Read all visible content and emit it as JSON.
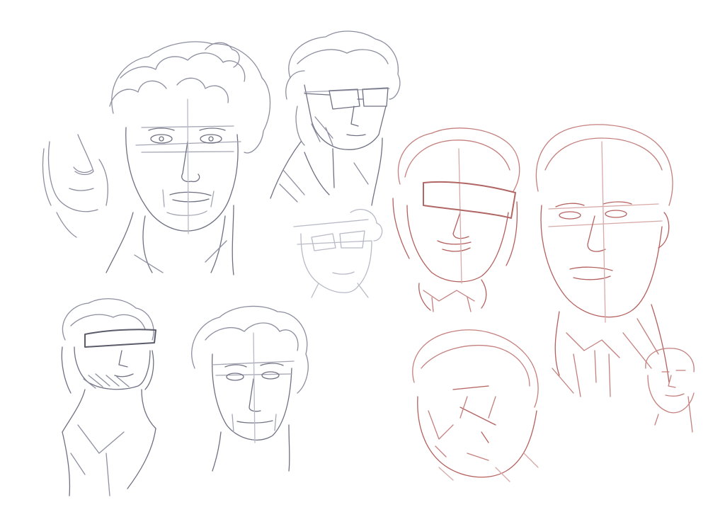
{
  "image": {
    "background": "#ffffff",
    "sketch_colors": {
      "grey_pencil": "#6f7183",
      "grey_light": "#a4a6b4",
      "red_pencil": "#b4615f",
      "red_light": "#cf9a98",
      "censor_grey": "#5a5c6a",
      "censor_red": "#b06664"
    },
    "groups": [
      {
        "name": "grey-sketches",
        "count": 6
      },
      {
        "name": "red-sketches",
        "count": 5
      }
    ]
  }
}
